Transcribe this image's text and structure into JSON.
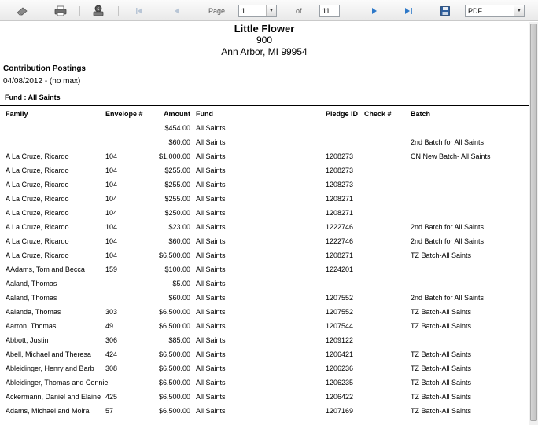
{
  "toolbar": {
    "page_label": "Page",
    "page_value": "1",
    "of_label": "of",
    "page_total": "11",
    "format_value": "PDF",
    "icons": [
      "eraser-icon",
      "printer-icon",
      "export-icon",
      "first-page-icon",
      "prev-page-icon",
      "next-page-icon",
      "last-page-icon",
      "save-icon"
    ],
    "accent": "#2e79c9"
  },
  "header": {
    "org_name": "Little Flower",
    "line2": "900",
    "line3": "Ann Arbor, MI 99954"
  },
  "report": {
    "title": "Contribution Postings",
    "range": "04/08/2012 - (no max)",
    "fund": "Fund : All Saints"
  },
  "columns": {
    "family": "Family",
    "envelope": "Envelope #",
    "amount": "Amount",
    "fund": "Fund",
    "pledge": "Pledge ID",
    "check": "Check #",
    "batch": "Batch"
  },
  "rows": [
    {
      "family": "",
      "envelope": "",
      "amount": "$454.00",
      "fund": "All Saints",
      "pledge": "",
      "batch": ""
    },
    {
      "family": "",
      "envelope": "",
      "amount": "$60.00",
      "fund": "All Saints",
      "pledge": "",
      "batch": "2nd Batch for All Saints"
    },
    {
      "family": "A La Cruze, Ricardo",
      "envelope": "104",
      "amount": "$1,000.00",
      "fund": "All Saints",
      "pledge": "1208273",
      "batch": "CN New Batch- All Saints"
    },
    {
      "family": "A La Cruze, Ricardo",
      "envelope": "104",
      "amount": "$255.00",
      "fund": "All Saints",
      "pledge": "1208273",
      "batch": ""
    },
    {
      "family": "A La Cruze, Ricardo",
      "envelope": "104",
      "amount": "$255.00",
      "fund": "All Saints",
      "pledge": "1208273",
      "batch": ""
    },
    {
      "family": "A La Cruze, Ricardo",
      "envelope": "104",
      "amount": "$255.00",
      "fund": "All Saints",
      "pledge": "1208271",
      "batch": ""
    },
    {
      "family": "A La Cruze, Ricardo",
      "envelope": "104",
      "amount": "$250.00",
      "fund": "All Saints",
      "pledge": "1208271",
      "batch": ""
    },
    {
      "family": "A La Cruze, Ricardo",
      "envelope": "104",
      "amount": "$23.00",
      "fund": "All Saints",
      "pledge": "1222746",
      "batch": "2nd Batch for All Saints"
    },
    {
      "family": "A La Cruze, Ricardo",
      "envelope": "104",
      "amount": "$60.00",
      "fund": "All Saints",
      "pledge": "1222746",
      "batch": "2nd Batch for All Saints"
    },
    {
      "family": "A La Cruze, Ricardo",
      "envelope": "104",
      "amount": "$6,500.00",
      "fund": "All Saints",
      "pledge": "1208271",
      "batch": "TZ Batch-All Saints"
    },
    {
      "family": "AAdams, Tom and Becca",
      "envelope": "159",
      "amount": "$100.00",
      "fund": "All Saints",
      "pledge": "1224201",
      "batch": ""
    },
    {
      "family": "Aaland, Thomas",
      "envelope": "",
      "amount": "$5.00",
      "fund": "All Saints",
      "pledge": "",
      "batch": ""
    },
    {
      "family": "Aaland, Thomas",
      "envelope": "",
      "amount": "$60.00",
      "fund": "All Saints",
      "pledge": "1207552",
      "batch": "2nd Batch for All Saints"
    },
    {
      "family": "Aalanda, Thomas",
      "envelope": "303",
      "amount": "$6,500.00",
      "fund": "All Saints",
      "pledge": "1207552",
      "batch": "TZ Batch-All Saints"
    },
    {
      "family": "Aarron, Thomas",
      "envelope": "49",
      "amount": "$6,500.00",
      "fund": "All Saints",
      "pledge": "1207544",
      "batch": "TZ Batch-All Saints"
    },
    {
      "family": "Abbott, Justin",
      "envelope": "306",
      "amount": "$85.00",
      "fund": "All Saints",
      "pledge": "1209122",
      "batch": ""
    },
    {
      "family": "Abell, Michael and Theresa",
      "envelope": "424",
      "amount": "$6,500.00",
      "fund": "All Saints",
      "pledge": "1206421",
      "batch": "TZ Batch-All Saints"
    },
    {
      "family": "Ableidinger, Henry and  Barb",
      "envelope": "308",
      "amount": "$6,500.00",
      "fund": "All Saints",
      "pledge": "1206236",
      "batch": "TZ Batch-All Saints"
    },
    {
      "family": "Ableidinger, Thomas and Connie",
      "envelope": "",
      "amount": "$6,500.00",
      "fund": "All Saints",
      "pledge": "1206235",
      "batch": "TZ Batch-All Saints"
    },
    {
      "family": "Ackermann, Daniel and  Elaine",
      "envelope": "425",
      "amount": "$6,500.00",
      "fund": "All Saints",
      "pledge": "1206422",
      "batch": "TZ Batch-All Saints"
    },
    {
      "family": "Adams, Michael and Moira",
      "envelope": "57",
      "amount": "$6,500.00",
      "fund": "All Saints",
      "pledge": "1207169",
      "batch": "TZ Batch-All Saints"
    }
  ]
}
